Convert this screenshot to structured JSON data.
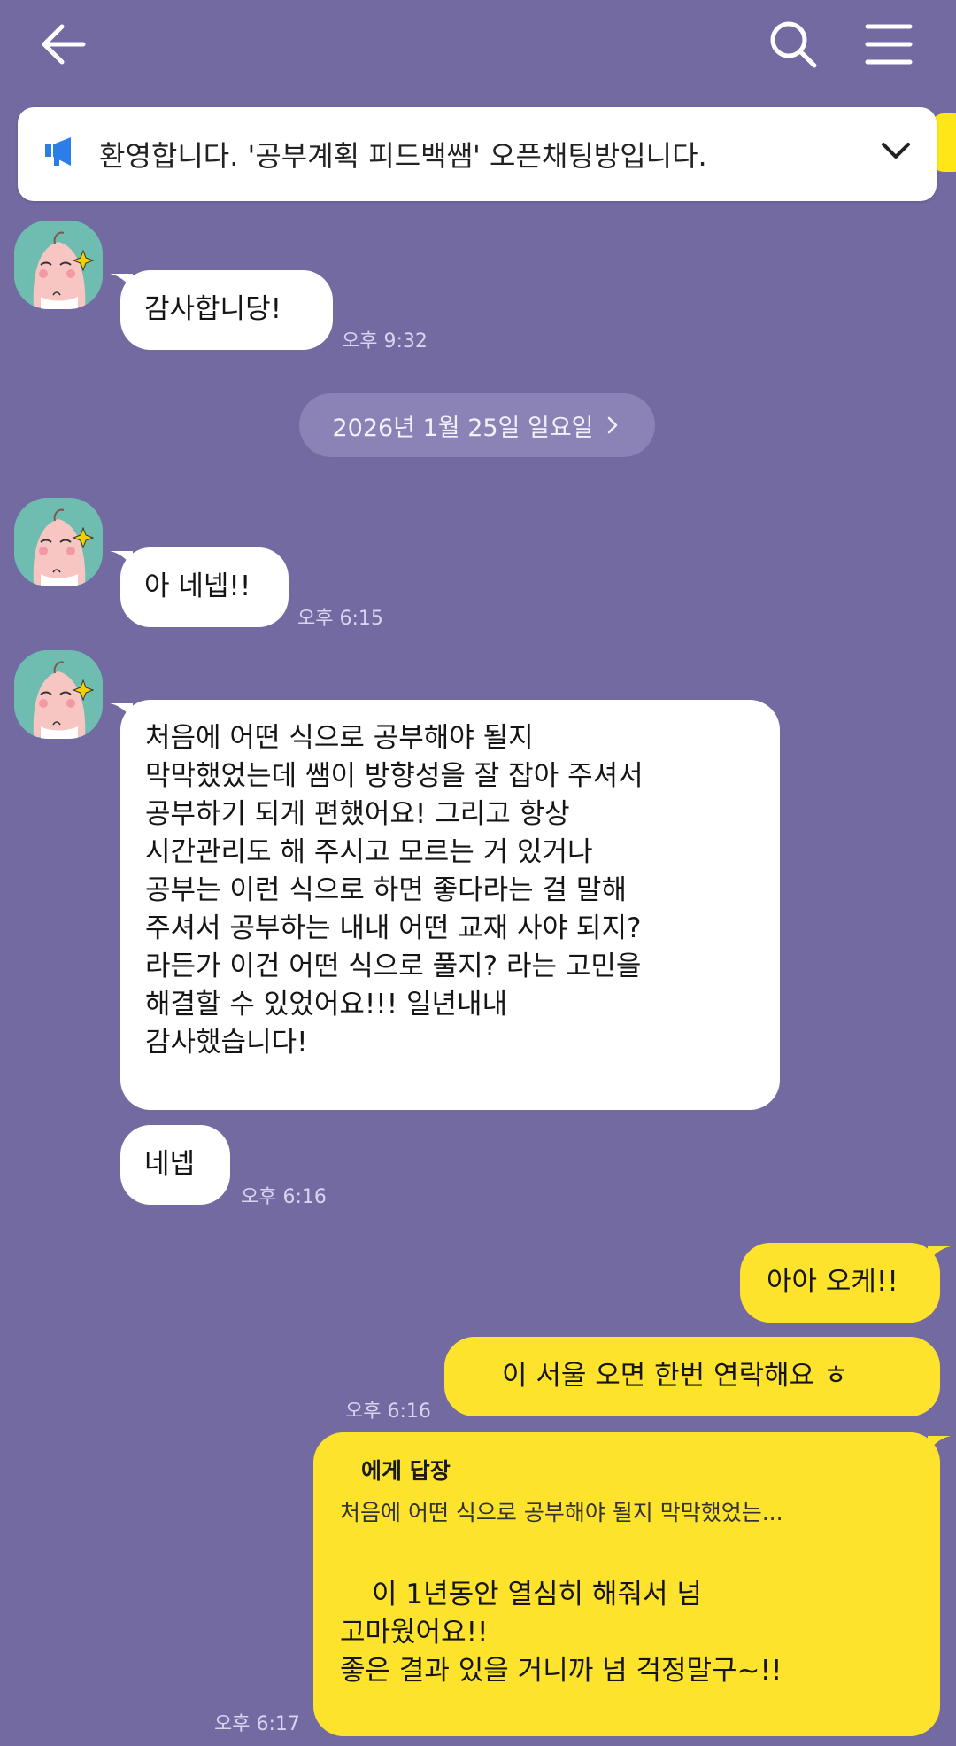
{
  "colors": {
    "background": "#736aa2",
    "my_bubble": "#fde32b",
    "other_bubble": "#ffffff",
    "notice_icon": "#2b7de9"
  },
  "icons": [
    "back-arrow-icon",
    "search-icon",
    "hamburger-menu-icon",
    "megaphone-icon",
    "chevron-down-icon",
    "chevron-right-icon",
    "apeach-avatar"
  ],
  "notice": {
    "text": "환영합니다. '공부계획  피드백쌤' 오픈채팅방입니다."
  },
  "date_divider": {
    "label": "2026년 1월 25일 일요일"
  },
  "messages": [
    {
      "sender": "other",
      "text": "감사합니당!",
      "time": "오후 9:32"
    },
    {
      "sender": "other",
      "text": "아 네넵!!",
      "time": "오후 6:15"
    },
    {
      "sender": "other",
      "lines": [
        "처음에 어떤 식으로 공부해야 될지",
        "막막했었는데 쌤이 방향성을 잘 잡아 주셔서",
        "공부하기 되게 편했어요! 그리고 항상",
        "시간관리도 해 주시고 모르는 거 있거나",
        "공부는 이런 식으로 하면 좋다라는 걸 말해",
        "주셔서 공부하는 내내 어떤 교재 사야 되지?",
        "라든가 이건 어떤 식으로 풀지? 라는 고민을",
        "해결할 수 있었어요!!! 일년내내",
        "감사했습니다!"
      ]
    },
    {
      "sender": "other",
      "text": "네넵",
      "time": "오후 6:16"
    },
    {
      "sender": "me",
      "text": "아아 오케!!"
    },
    {
      "sender": "me",
      "text": "이 서울 오면 한번 연락해요 ㅎ",
      "time": "오후 6:16"
    },
    {
      "sender": "me",
      "reply_to": "에게 답장",
      "quote": "처음에 어떤 식으로 공부해야 될지 막막했었는...",
      "lines": [
        "이 1년동안 열심히 해줘서 넘",
        "고마웠어요!!",
        "좋은 결과 있을 거니까 넘 걱정말구~!!"
      ],
      "time": "오후 6:17"
    }
  ]
}
